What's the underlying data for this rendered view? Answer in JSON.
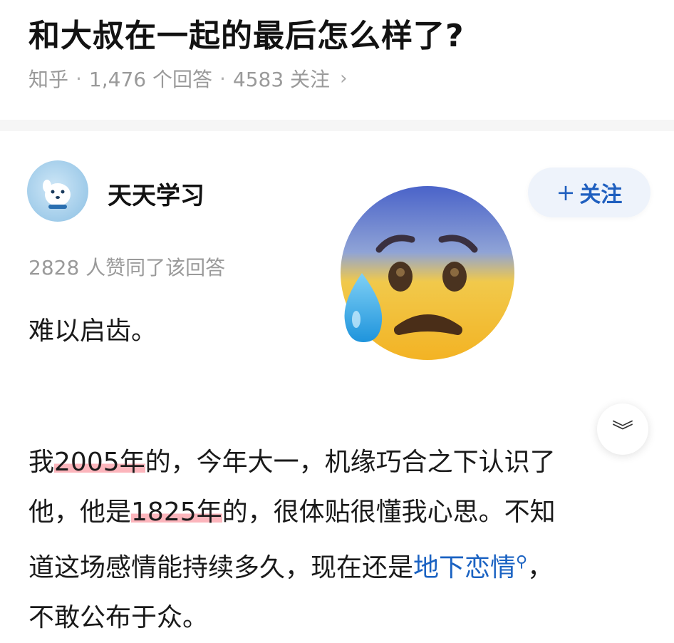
{
  "question": {
    "title": "和大叔在一起的最后怎么样了?",
    "source": "知乎",
    "answers": "1,476 个回答",
    "followers": "4583 关注",
    "sep": "·",
    "chevron": "›"
  },
  "author": {
    "name": "天天学习",
    "avatar_icon": "dog-avatar",
    "follow_label": "关注",
    "follow_plus": "+"
  },
  "answer": {
    "votes": "2828 人赞同了该回答",
    "para1": "难以启齿。",
    "emoji_icon": "anxious-face-with-sweat-emoji",
    "collapse_icon": "double-chevron-down-icon",
    "collapse_glyph": "︾",
    "line1_pre": "我",
    "line1_hl": "2005年",
    "line1_post": "的，今年大一，机缘巧合之下认识了",
    "line2_pre": "他，他是",
    "line2_hl": "1825年",
    "line2_post": "的，很体贴很懂我心思。不知",
    "line3_pre": "道这场感情能持续多久，现在还是",
    "line3_link": "地下恋情",
    "line3_post": "，",
    "line4": "不敢公布于众。"
  },
  "colors": {
    "link": "#1a62c2",
    "highlight": "#fa96a0",
    "follow_bg": "#eef3fb"
  }
}
